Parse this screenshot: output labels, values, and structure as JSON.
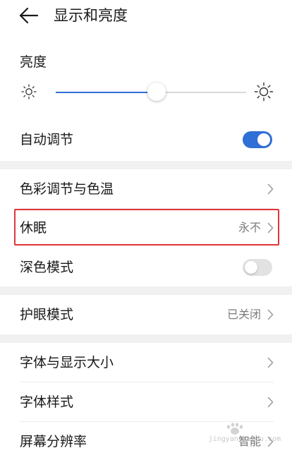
{
  "header": {
    "title": "显示和亮度",
    "back_icon": "arrow-left-icon"
  },
  "brightness": {
    "label": "亮度",
    "level_fraction": 0.53,
    "min_icon": "sun-small-icon",
    "max_icon": "sun-large-icon"
  },
  "auto_adjust": {
    "label": "自动调节",
    "enabled": true
  },
  "display_rows": [
    {
      "label": "色彩调节与色温",
      "value": ""
    },
    {
      "label": "休眠",
      "value": "永不"
    }
  ],
  "dark_mode": {
    "label": "深色模式",
    "enabled": false
  },
  "eye_comfort": {
    "label": "护眼模式",
    "value": "已关闭"
  },
  "font_rows": [
    {
      "label": "字体与显示大小",
      "value": ""
    },
    {
      "label": "字体样式",
      "value": ""
    },
    {
      "label": "屏幕分辨率",
      "value": "智能"
    }
  ],
  "watermark": {
    "text": "jingyan.baidu.com"
  },
  "colors": {
    "accent": "#2f6fd6",
    "highlight_border": "#e0343a",
    "section_gap": "#f1f1f1"
  }
}
